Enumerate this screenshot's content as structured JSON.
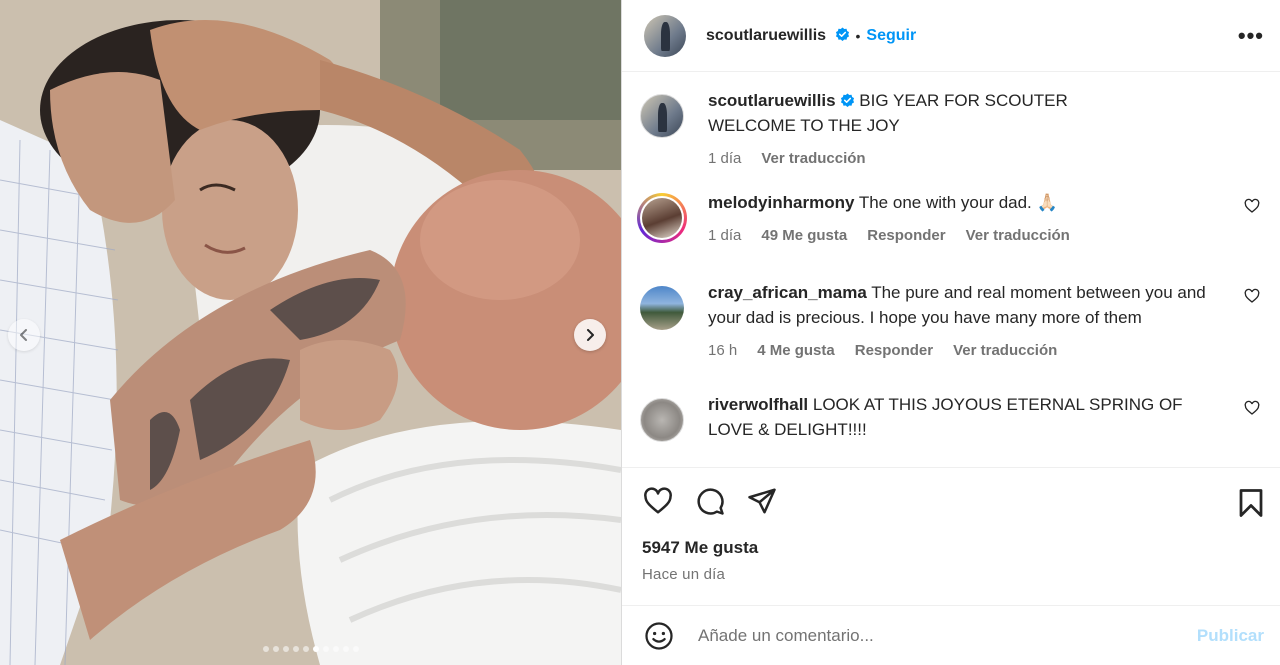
{
  "post": {
    "author": "scoutlaruewillis",
    "follow_label": "Seguir",
    "separator": "•",
    "more_label": "•••"
  },
  "carousel": {
    "slide_count": 10,
    "active_index": 5
  },
  "caption": {
    "user": "scoutlaruewillis",
    "line1": "BIG YEAR FOR SCOUTER",
    "line2": "WELCOME TO THE JOY",
    "time": "1 día",
    "translate": "Ver traducción"
  },
  "comments": [
    {
      "user": "melodyinharmony",
      "text": "The one with your dad. 🙏🏻",
      "time": "1 día",
      "likes": "49 Me gusta",
      "reply": "Responder",
      "translate": "Ver traducción"
    },
    {
      "user": "cray_african_mama",
      "text": "The pure and real moment between you and your dad is precious. I hope you have many more of them",
      "time": "16 h",
      "likes": "4 Me gusta",
      "reply": "Responder",
      "translate": "Ver traducción"
    },
    {
      "user": "riverwolfhall",
      "text": "LOOK AT THIS JOYOUS ETERNAL SPRING OF LOVE & DELIGHT!!!!"
    }
  ],
  "footer": {
    "likes": "5947 Me gusta",
    "time": "Hace un día",
    "comment_placeholder": "Añade un comentario...",
    "publish_label": "Publicar"
  },
  "icons": {
    "verified": "verified-badge-icon",
    "like": "heart-icon",
    "comment": "comment-icon",
    "share": "send-icon",
    "save": "bookmark-icon",
    "emoji": "emoji-icon"
  },
  "colors": {
    "accent": "#0095f6",
    "verified": "#0095f6",
    "publish_disabled": "#b2dffc",
    "muted_text": "#737373"
  }
}
